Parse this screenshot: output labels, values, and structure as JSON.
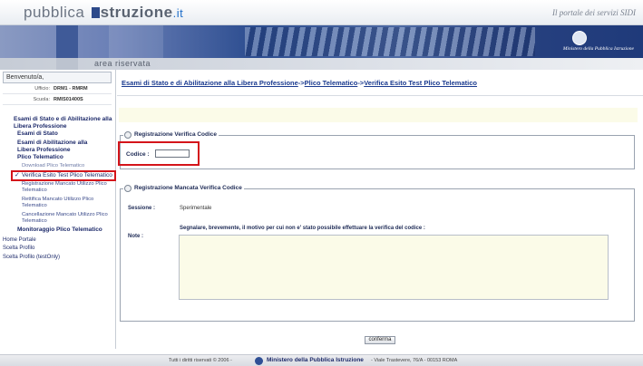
{
  "header": {
    "logo_pre": "pubblica",
    "logo_post": "struzione",
    "logo_domain": ".it",
    "portal_tagline": "Il portale dei servizi SIDI",
    "ministry_name": "Ministero della Pubblica Istruzione",
    "area_label": "area riservata"
  },
  "user": {
    "welcome": "Benvenuto/a, ",
    "office_label": "Ufficio:",
    "office_value": "DRM1 - RMRM",
    "school_label": "Scuola:",
    "school_value": "RMIS01400S"
  },
  "sidebar": {
    "section_title": "Esami di Stato e di Abilitazione alla Libera Professione",
    "items": [
      {
        "label": "Esami di Stato"
      },
      {
        "label": "Esami di Abilitazione alla Libera Professione"
      },
      {
        "label": "Plico Telematico"
      },
      {
        "label": "Download Plico Telematico"
      },
      {
        "label": "Verifica Esito Test Plico Telematico"
      },
      {
        "label": "Registrazione Mancato Utilizzo Plico Telematico"
      },
      {
        "label": "Rettifica Mancato Utilizzo Plico Telematico"
      },
      {
        "label": "Cancellazione Mancato Utilizzo Plico Telematico"
      },
      {
        "label": "Monitoraggio Plico Telematico"
      },
      {
        "label": "Home Portale"
      },
      {
        "label": "Scelta Profilo"
      },
      {
        "label": "Scelta Profilo (testOnly)"
      }
    ]
  },
  "breadcrumb": {
    "items": [
      "Esami di Stato e di Abilitazione alla Libera Professione",
      "Plico Telematico",
      "Verifica Esito Test Plico Telematico"
    ],
    "separator": "->"
  },
  "form": {
    "verify_legend": "Registrazione Verifica Codice",
    "codice_label": "Codice :",
    "codice_value": "",
    "not_verified_legend": "Registrazione Mancata Verifica Codice",
    "session_label": "Sessione :",
    "session_value": "Sperimentale",
    "note_label": "Note :",
    "note_prompt": "Segnalare, brevemente, il motivo per cui non e' stato possibile effettuare la verifica del codice :",
    "note_value": "",
    "confirm_label": "conferma"
  },
  "footer": {
    "rights": "Tutti i diritti riservati © 2006 -",
    "ministry": "Ministero della Pubblica Istruzione",
    "address": "- Viale Trastevere, 76/A - 00153 ROMA"
  },
  "colors": {
    "highlight_border": "#d4141a",
    "link_blue": "#1a3a8f",
    "banner_blue": "#2b4c8f",
    "note_bg": "#fbfbe8"
  },
  "icons": {
    "active_marker": "check-icon",
    "emblem": "republic-emblem-icon"
  }
}
